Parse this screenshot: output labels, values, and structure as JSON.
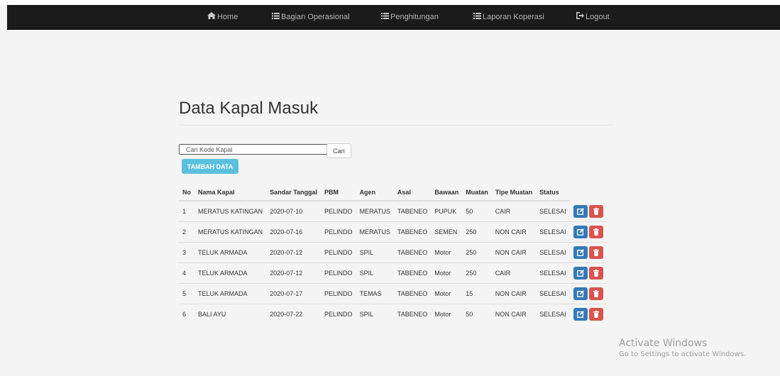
{
  "nav": {
    "home": "Home",
    "operasional": "Bagian Operasional",
    "penghitungan": "Penghitungan",
    "laporan": "Laporan Koperasi",
    "logout": "Logout"
  },
  "page": {
    "title": "Data Kapal Masuk"
  },
  "search": {
    "placeholder": "Cari Kode Kapal",
    "button": "Cari"
  },
  "add_button": "TAMBAH DATA",
  "table": {
    "headers": [
      "No",
      "Nama Kapal",
      "Sandar Tanggal",
      "PBM",
      "Agen",
      "Asal",
      "Bawaan",
      "Muatan",
      "Tipe Muatan",
      "Status"
    ],
    "rows": [
      [
        "1",
        "MERATUS KATINGAN",
        "2020-07-10",
        "PELINDO",
        "MERATUS",
        "TABENEO",
        "PUPUK",
        "50",
        "CAIR",
        "SELESAI"
      ],
      [
        "2",
        "MERATUS KATINGAN",
        "2020-07-16",
        "PELINDO",
        "MERATUS",
        "TABENEO",
        "SEMEN",
        "250",
        "NON CAIR",
        "SELESAI"
      ],
      [
        "3",
        "TELUK ARMADA",
        "2020-07-12",
        "PELINDO",
        "SPIL",
        "TABENEO",
        "Motor",
        "250",
        "NON CAIR",
        "SELESAI"
      ],
      [
        "4",
        "TELUK ARMADA",
        "2020-07-12",
        "PELINDO",
        "SPIL",
        "TABENEO",
        "Motor",
        "250",
        "CAIR",
        "SELESAI"
      ],
      [
        "5",
        "TELUK ARMADA",
        "2020-07-17",
        "PELINDO",
        "TEMAS",
        "TABENEO",
        "Motor",
        "15",
        "NON CAIR",
        "SELESAI"
      ],
      [
        "6",
        "BALI AYU",
        "2020-07-22",
        "PELINDO",
        "SPIL",
        "TABENEO",
        "Motor",
        "50",
        "NON CAIR",
        "SELESAI"
      ]
    ]
  },
  "icons": {
    "home": "home-icon",
    "list": "list-icon",
    "logout": "logout-icon",
    "edit": "edit-icon",
    "delete": "trash-icon"
  },
  "colors": {
    "navbar": "#1b1b1b",
    "info": "#5bc0de",
    "primary": "#337ab7",
    "danger": "#d9534f"
  },
  "watermark": {
    "title": "Activate Windows",
    "subtitle": "Go to Settings to activate Windows."
  }
}
